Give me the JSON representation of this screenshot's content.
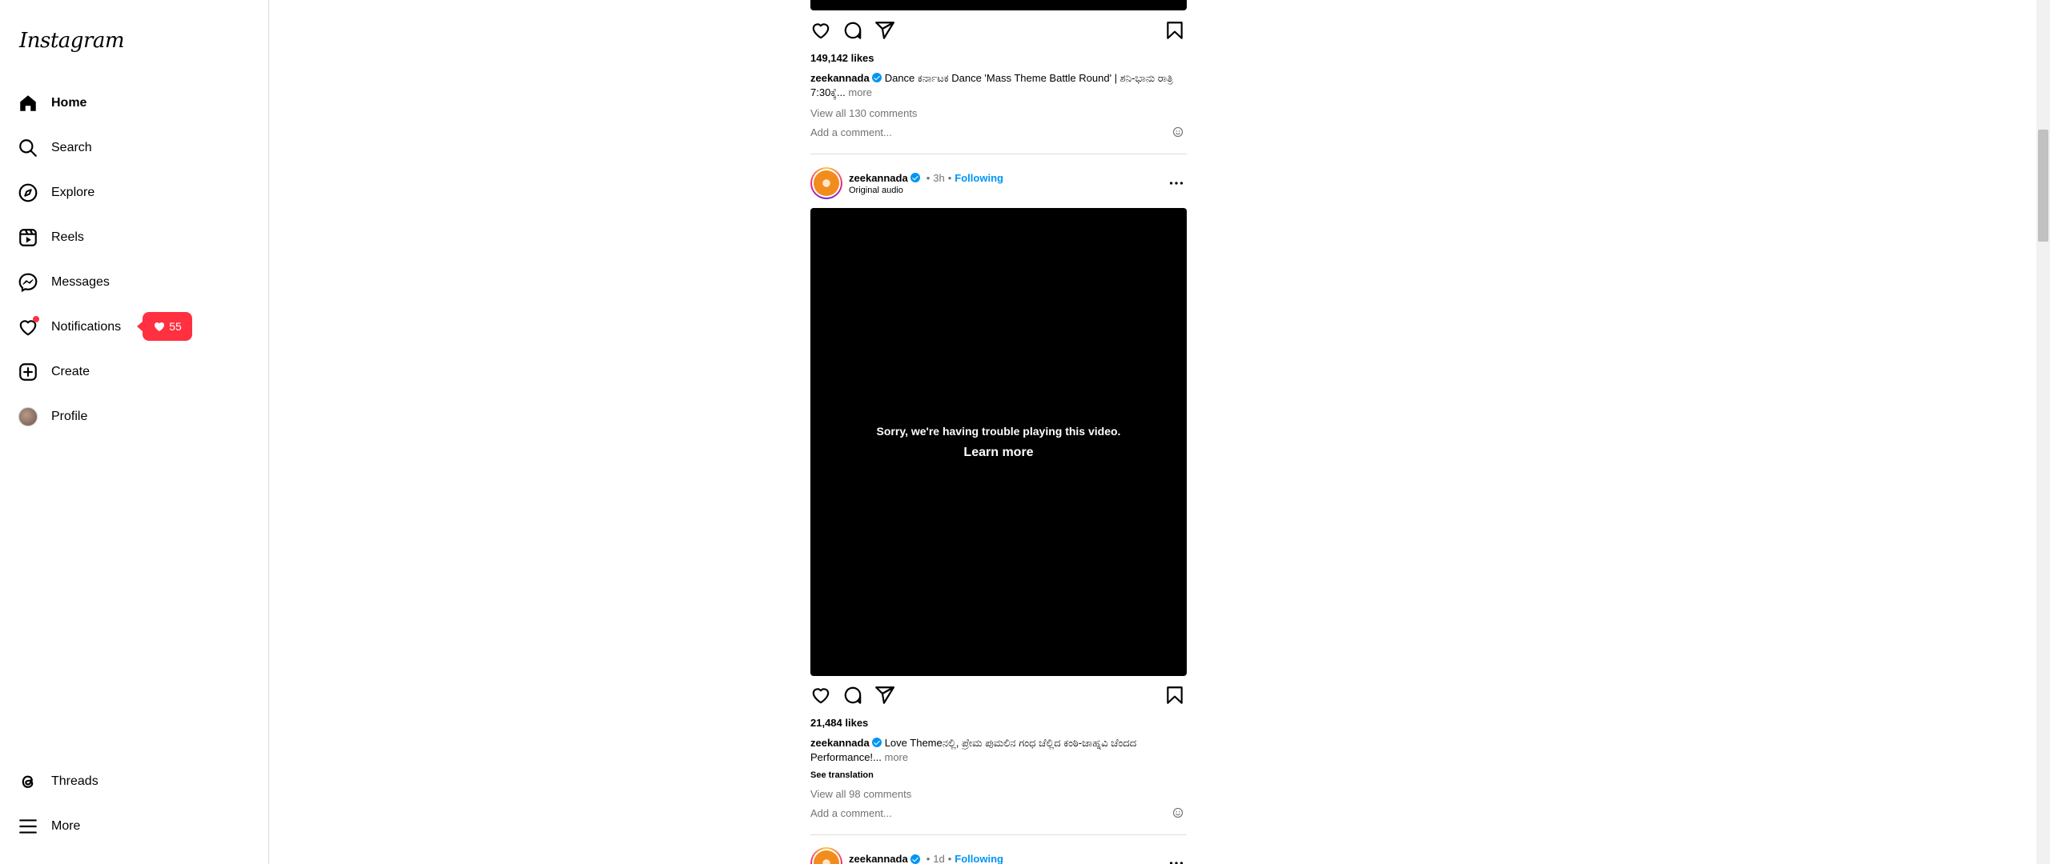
{
  "app": {
    "logo": "Instagram"
  },
  "sidebar": {
    "items": [
      {
        "label": "Home",
        "icon": "home-icon"
      },
      {
        "label": "Search",
        "icon": "search-icon"
      },
      {
        "label": "Explore",
        "icon": "compass-icon"
      },
      {
        "label": "Reels",
        "icon": "reels-icon"
      },
      {
        "label": "Messages",
        "icon": "messenger-icon"
      },
      {
        "label": "Notifications",
        "icon": "heart-icon"
      },
      {
        "label": "Create",
        "icon": "plus-square-icon"
      },
      {
        "label": "Profile",
        "icon": "avatar"
      }
    ],
    "bottom_items": [
      {
        "label": "Threads",
        "icon": "threads-icon"
      },
      {
        "label": "More",
        "icon": "menu-icon"
      }
    ],
    "notification_count": "55"
  },
  "feed": {
    "post1": {
      "likes": "149,142 likes",
      "username": "zeekannada",
      "caption": "Dance ಕರ್ನಾಟಕ Dance 'Mass Theme Battle Round' | ಶನಿ-ಭಾನು ರಾತ್ರಿ 7:30ಕ್ಕೆ...",
      "more": "more",
      "view_comments": "View all 130 comments",
      "add_comment_placeholder": "Add a comment..."
    },
    "post2": {
      "username": "zeekannada",
      "time": "3h",
      "following": "Following",
      "audio": "Original audio",
      "video_error": "Sorry, we're having trouble playing this video.",
      "learn_more": "Learn more",
      "likes": "21,484 likes",
      "caption": "Love Themeನಲ್ಲಿ, ಪ್ರೇಮ ಪುಮಲಿನ ಗಂಧ ಚೆಲ್ಲಿದ ಕಂಠಿ-ಜಾಹ್ನವಿ ಚೆಂದದ Performance!...",
      "more": "more",
      "see_translation": "See translation",
      "view_comments": "View all 98 comments",
      "add_comment_placeholder": "Add a comment..."
    },
    "post3": {
      "username": "zeekannada",
      "time": "1d",
      "following": "Following"
    }
  }
}
